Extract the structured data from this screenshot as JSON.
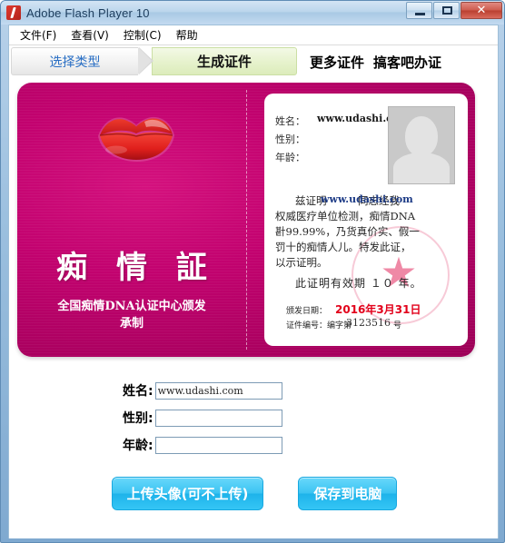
{
  "window": {
    "title": "Adobe Flash Player 10",
    "icon": "flash-icon",
    "controls": {
      "minimize": "minimize-icon",
      "maximize": "maximize-icon",
      "close": "✕"
    }
  },
  "menubar": {
    "items": [
      {
        "label": "文件(F)"
      },
      {
        "label": "查看(V)"
      },
      {
        "label": "控制(C)"
      },
      {
        "label": "帮助"
      }
    ]
  },
  "stepnav": {
    "steps": [
      {
        "label": "选择类型",
        "state": "inactive"
      },
      {
        "label": "生成证件",
        "state": "active"
      }
    ],
    "links": [
      {
        "label": "更多证件"
      },
      {
        "label": "搞客吧办证"
      }
    ]
  },
  "card": {
    "bg_color": "#c2026f",
    "left": {
      "illustration": "red-lips-icon",
      "title": "痴 情 証",
      "subtitle1": "全国痴情DNA认证中心颁发",
      "subtitle2": "承制"
    },
    "right": {
      "name_label": "姓名：",
      "name_value": "www.udashi.com",
      "gender_label": "性别：",
      "gender_value": "",
      "age_label": "年龄：",
      "age_value": "",
      "photo": "photo-placeholder-icon",
      "body_line1": "兹证明　　　同志经我",
      "body_line2": "权威医疗单位检测，痴情DNA",
      "body_line3": "卙99.99%，乃货真价实、假一",
      "body_line4": "罚十的痴情人儿。特发此证，",
      "body_line5": "以示证明。",
      "watermark": "www.udashi.com",
      "validity": "此证明有效期 １０ 年。",
      "date_label": "颁发日期：",
      "date_value": "2016年3月31日",
      "number_label": "证件编号：编字第",
      "number_value": "3123516",
      "number_suffix": "号",
      "seal": "red-official-seal-icon"
    }
  },
  "form": {
    "fields": [
      {
        "label": "姓名:",
        "value": "www.udashi.com",
        "placeholder": ""
      },
      {
        "label": "性别:",
        "value": "",
        "placeholder": ""
      },
      {
        "label": "年龄:",
        "value": "",
        "placeholder": ""
      }
    ]
  },
  "buttons": {
    "upload": "上传头像(可不上传)",
    "save": "保存到电脑",
    "accent_color": "#2bbdf0"
  }
}
